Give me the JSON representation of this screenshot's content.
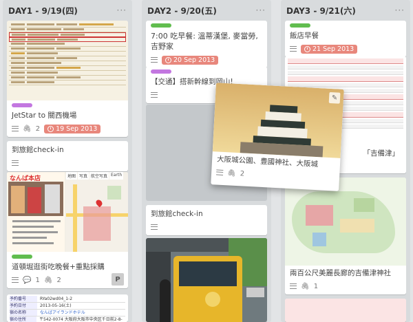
{
  "lists": [
    {
      "title": "DAY1 - 9/19(四)",
      "menu": "···",
      "cards": [
        {
          "label_color": "#c377e0",
          "title": "JetStar to 關西機場",
          "attachments": "2",
          "due": "19 Sep 2013"
        },
        {
          "title": "到旅館check-in"
        },
        {
          "map_tabs": [
            "地图",
            "写真",
            "航空写真",
            "Earth"
          ],
          "map_title": "なんば本店",
          "label_color": "#61bd4f",
          "title": "道頓堀逛街吃晚餐+重點採購",
          "comments": "1",
          "attachments": "2",
          "avatar": "P"
        },
        {
          "table_rows": [
            "予約番号",
            "予約日付",
            "宿の名称",
            "宿の住所"
          ],
          "table_values": [
            "RYa02wd04_1-2",
            "2013-05-16(土)",
            "なんばアイランドホテル",
            "〒542-0074 大阪府大阪市中央区千日前2-8-17"
          ]
        }
      ]
    },
    {
      "title": "DAY2 - 9/20(五)",
      "menu": "···",
      "cards": [
        {
          "label_color": "#61bd4f",
          "title": "7:00 吃早餐: 溫蒂漢堡, 麥當勞, 吉野家",
          "due": "20 Sep 2013"
        },
        {
          "label_color": "#c377e0",
          "title": "【交通】搭新幹線到岡山!"
        },
        {
          "title": "到旅館check-in"
        }
      ]
    },
    {
      "title": "DAY3 - 9/21(六)",
      "menu": "···",
      "cards": [
        {
          "label_color": "#61bd4f",
          "title": "飯店早餐",
          "due": "21 Sep 2013"
        },
        {
          "title": "「吉備津」"
        },
        {
          "title": "兩百公尺美麗長廊的吉備津神社",
          "attachments": "1"
        }
      ]
    }
  ],
  "dragging_card": {
    "title": "大阪城公園、豊國神社、大阪城",
    "attachments": "2"
  }
}
